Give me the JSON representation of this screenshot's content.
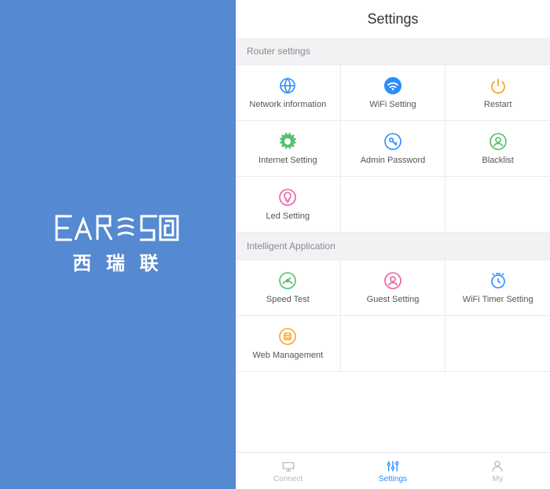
{
  "brand": {
    "logo_text": "EARES",
    "subtitle": "西 瑞 联"
  },
  "page": {
    "title": "Settings"
  },
  "sections": {
    "router": {
      "header": "Router settings",
      "tiles": {
        "network_info": "Network information",
        "wifi_setting": "WiFi Setting",
        "restart": "Restart",
        "internet_setting": "Internet Setting",
        "admin_password": "Admin Password",
        "blacklist": "Blacklist",
        "led_setting": "Led Setting"
      }
    },
    "intelligent": {
      "header": "Intelligent Application",
      "tiles": {
        "speed_test": "Speed Test",
        "guest_setting": "Guest Setting",
        "wifi_timer": "WiFi Timer Setting",
        "web_management": "Web Management"
      }
    }
  },
  "tabs": {
    "connect": "Connect",
    "settings": "Settings",
    "my": "My"
  },
  "colors": {
    "brand_blue": "#5589d1",
    "icon_blue": "#298cff",
    "icon_orange": "#f6a728",
    "icon_green": "#4ebf67",
    "icon_pink": "#e85fa0"
  }
}
